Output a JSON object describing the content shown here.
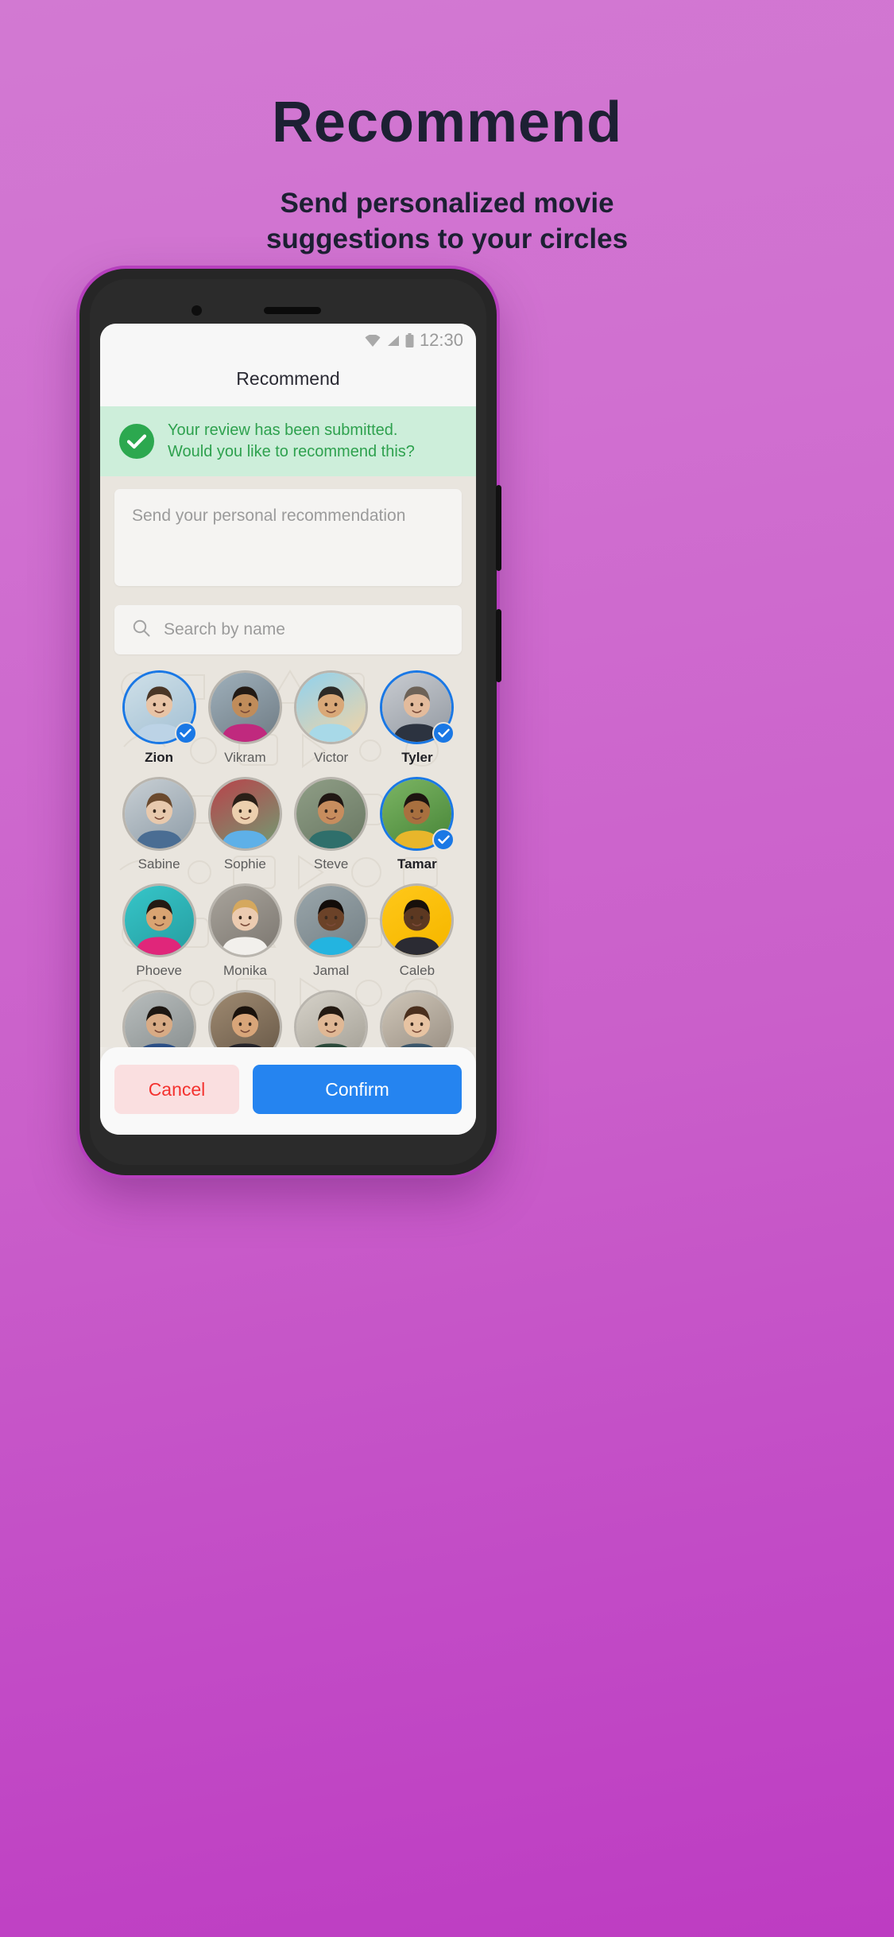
{
  "promo": {
    "title": "Recommend",
    "subtitle_line1": "Send personalized movie",
    "subtitle_line2": "suggestions to your circles",
    "title_color": "#1d2033",
    "background_gradient_from": "#d279d2",
    "background_gradient_to": "#bd3cc2"
  },
  "statusbar": {
    "time": "12:30",
    "wifi_icon": "wifi-icon",
    "signal_icon": "signal-icon",
    "battery_icon": "battery-icon",
    "icon_color": "#9a9a9a"
  },
  "appbar": {
    "title": "Recommend"
  },
  "banner": {
    "icon": "check-circle-icon",
    "line1": "Your  review  has been submitted.",
    "line2": "Would you like to recommend this?",
    "background": "#cdeeda",
    "text_color": "#2ea14e",
    "icon_background": "#2ca84f"
  },
  "message": {
    "placeholder": "Send your personal recommendation",
    "value": ""
  },
  "search": {
    "icon": "search-icon",
    "placeholder": "Search by name",
    "value": ""
  },
  "contacts": [
    {
      "name": "Zion",
      "selected": true,
      "skin": "#e8c4a6",
      "bg1": "#cfe0e8",
      "bg2": "#a9c4d6",
      "shirt": "#bcd3e6",
      "hair": "#4a3626"
    },
    {
      "name": "Vikram",
      "selected": false,
      "skin": "#c08c5a",
      "bg1": "#9fb0bb",
      "bg2": "#76838c",
      "shirt": "#c0297e",
      "hair": "#231a14"
    },
    {
      "name": "Victor",
      "selected": false,
      "skin": "#d9a878",
      "bg1": "#8fd2ef",
      "bg2": "#e6d3ae",
      "shirt": "#a8d9e8",
      "hair": "#2d2a26"
    },
    {
      "name": "Tyler",
      "selected": true,
      "skin": "#e3bb9c",
      "bg1": "#c9ccd1",
      "bg2": "#9aa0a8",
      "shirt": "#2c3340",
      "hair": "#6d6257"
    },
    {
      "name": "Sabine",
      "selected": false,
      "skin": "#e8c9ad",
      "bg1": "#c8cfd4",
      "bg2": "#97a4ae",
      "shirt": "#4a6d93",
      "hair": "#6b4a2e"
    },
    {
      "name": "Sophie",
      "selected": false,
      "skin": "#eccfae",
      "bg1": "#b9424a",
      "bg2": "#7c8f6d",
      "shirt": "#5eb0e8",
      "hair": "#2a1f17"
    },
    {
      "name": "Steve",
      "selected": false,
      "skin": "#c78d5e",
      "bg1": "#8f9e86",
      "bg2": "#6f7d68",
      "shirt": "#2f6f6b",
      "hair": "#201713"
    },
    {
      "name": "Tamar",
      "selected": true,
      "skin": "#a8703f",
      "bg1": "#7cb564",
      "bg2": "#4e8b3d",
      "shirt": "#e8b62b",
      "hair": "#1d1410"
    },
    {
      "name": "Phoeve",
      "selected": false,
      "skin": "#d9a472",
      "bg1": "#36c6c9",
      "bg2": "#28a3a6",
      "shirt": "#e0267a",
      "hair": "#241a13"
    },
    {
      "name": "Monika",
      "selected": false,
      "skin": "#eccbb0",
      "bg1": "#a9a49c",
      "bg2": "#827d76",
      "shirt": "#f2f0ec",
      "hair": "#d5a85e"
    },
    {
      "name": "Jamal",
      "selected": false,
      "skin": "#6b4228",
      "bg1": "#9aa6ab",
      "bg2": "#7a868b",
      "shirt": "#23b4e0",
      "hair": "#120c09"
    },
    {
      "name": "Caleb",
      "selected": false,
      "skin": "#5c3821",
      "bg1": "#ffc81a",
      "bg2": "#f7b800",
      "shirt": "#2b2b33",
      "hair": "#17100b"
    },
    {
      "name": "",
      "selected": false,
      "skin": "#d8ab85",
      "bg1": "#b8bdbd",
      "bg2": "#8e9494",
      "shirt": "#2b4f86",
      "hair": "#1d1712"
    },
    {
      "name": "",
      "selected": false,
      "skin": "#d8a579",
      "bg1": "#9f8a71",
      "bg2": "#6f5f4d",
      "shirt": "#25242a",
      "hair": "#1a120c"
    },
    {
      "name": "",
      "selected": false,
      "skin": "#e0b895",
      "bg1": "#d6d2c9",
      "bg2": "#aaa69c",
      "shirt": "#2c4a3a",
      "hair": "#241a12"
    },
    {
      "name": "",
      "selected": false,
      "skin": "#e7c3a2",
      "bg1": "#cfc6b8",
      "bg2": "#9e9488",
      "shirt": "#3b566b",
      "hair": "#4a2f1d"
    }
  ],
  "actions": {
    "cancel_label": "Cancel",
    "confirm_label": "Confirm",
    "cancel_bg": "#fadfe0",
    "cancel_fg": "#f4322f",
    "confirm_bg": "#2584f0",
    "confirm_fg": "#ffffff"
  }
}
